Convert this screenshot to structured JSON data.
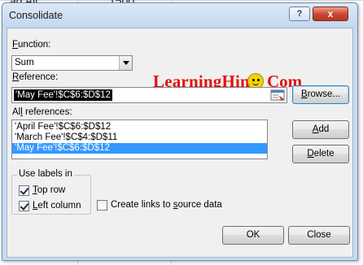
{
  "background": {
    "cell_text": "ad Ali",
    "cell_value": "1500"
  },
  "dialog": {
    "title": "Consolidate",
    "help_button": "?",
    "close_button": "x"
  },
  "function": {
    "label_prefix": "",
    "label_hotkey": "F",
    "label_rest": "unction:",
    "value": "Sum"
  },
  "reference": {
    "label_prefix": "",
    "label_hotkey": "R",
    "label_rest": "eference:",
    "value": "'May Fee'!$C$6:$D$12"
  },
  "buttons": {
    "browse_prefix": "",
    "browse_hotkey": "B",
    "browse_rest": "rowse...",
    "add_prefix": "",
    "add_hotkey": "A",
    "add_rest": "dd",
    "delete_prefix": "",
    "delete_hotkey": "D",
    "delete_rest": "elete",
    "ok": "OK",
    "close": "Close"
  },
  "all_references": {
    "label_prefix": "Al",
    "label_hotkey": "l",
    "label_rest": " references:",
    "items": [
      "'April Fee'!$C$6:$D$12",
      "'March Fee'!$C$4:$D$11",
      "'May Fee'!$C$6:$D$12"
    ],
    "selected_index": 2
  },
  "use_labels": {
    "title": "Use labels in",
    "top_row_prefix": "",
    "top_row_hotkey": "T",
    "top_row_rest": "op row",
    "top_row_checked": true,
    "left_column_prefix": "",
    "left_column_hotkey": "L",
    "left_column_rest": "eft column",
    "left_column_checked": true
  },
  "create_links": {
    "label_prefix": "Create links to ",
    "label_hotkey": "s",
    "label_rest": "ource data",
    "checked": false
  },
  "watermark": {
    "text": "LearningHints",
    "suffix": "Com",
    "smiley_color": "#f4d400",
    "text_color": "#e0130f"
  }
}
